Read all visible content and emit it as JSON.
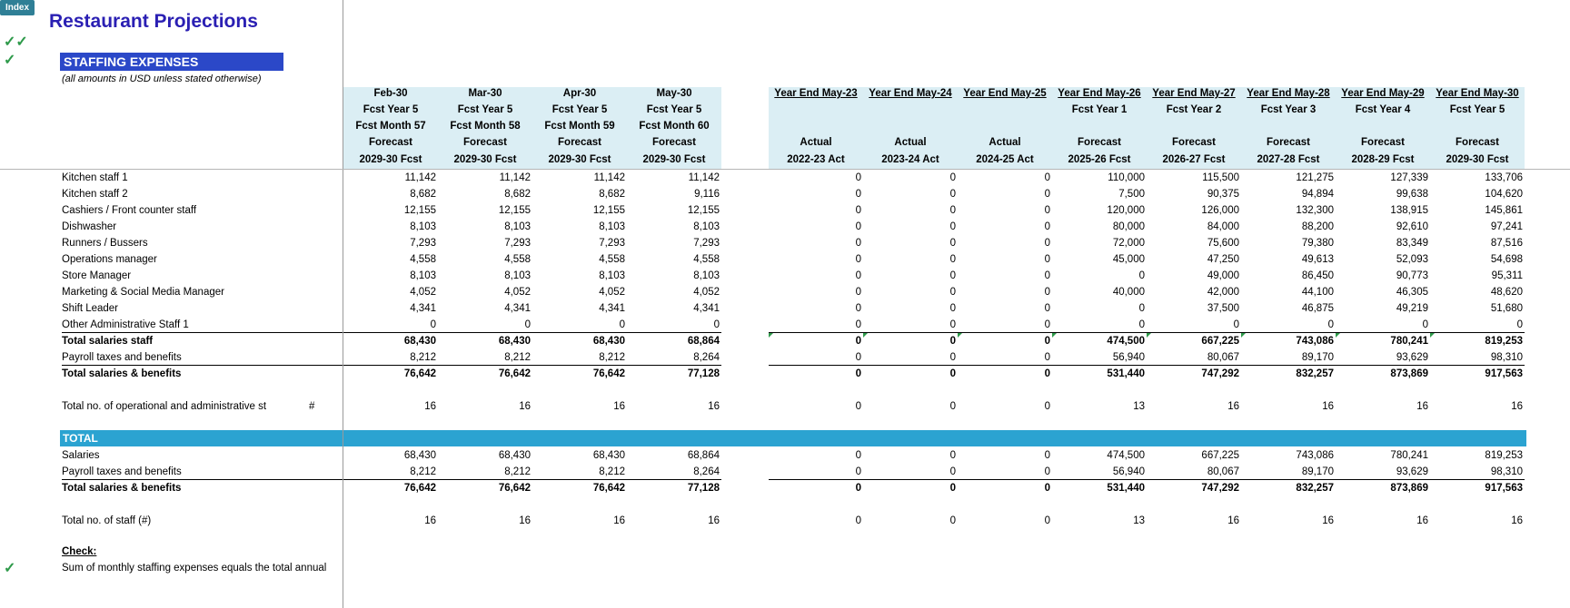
{
  "app": {
    "index_button": "Index",
    "title": "Restaurant Projections",
    "section": "STAFFING EXPENSES",
    "subtitle": "(all amounts in USD unless stated otherwise)",
    "check_mark": "✓",
    "double_check": "✓✓"
  },
  "colors": {
    "title": "#2a1fb3",
    "banner": "#2b48c8",
    "total_banner": "#2ba3d1",
    "header_bg": "#dbeef4",
    "check": "#2e9a4a"
  },
  "monthly_columns": [
    {
      "h1": "Feb-30",
      "h2": "Fcst Year 5",
      "h3": "Fcst Month 57",
      "h4": "Forecast",
      "h5": "2029-30 Fcst"
    },
    {
      "h1": "Mar-30",
      "h2": "Fcst Year 5",
      "h3": "Fcst Month 58",
      "h4": "Forecast",
      "h5": "2029-30 Fcst"
    },
    {
      "h1": "Apr-30",
      "h2": "Fcst Year 5",
      "h3": "Fcst Month 59",
      "h4": "Forecast",
      "h5": "2029-30 Fcst"
    },
    {
      "h1": "May-30",
      "h2": "Fcst Year 5",
      "h3": "Fcst Month 60",
      "h4": "Forecast",
      "h5": "2029-30 Fcst"
    }
  ],
  "annual_columns": [
    {
      "h1": "Year End  May-23",
      "h2": "",
      "h4": "Actual",
      "h5": "2022-23 Act"
    },
    {
      "h1": "Year End  May-24",
      "h2": "",
      "h4": "Actual",
      "h5": "2023-24 Act"
    },
    {
      "h1": "Year End  May-25",
      "h2": "",
      "h4": "Actual",
      "h5": "2024-25 Act"
    },
    {
      "h1": "Year End  May-26",
      "h2": "Fcst Year 1",
      "h4": "Forecast",
      "h5": "2025-26 Fcst"
    },
    {
      "h1": "Year End  May-27",
      "h2": "Fcst Year 2",
      "h4": "Forecast",
      "h5": "2026-27 Fcst"
    },
    {
      "h1": "Year End  May-28",
      "h2": "Fcst Year 3",
      "h4": "Forecast",
      "h5": "2027-28 Fcst"
    },
    {
      "h1": "Year End  May-29",
      "h2": "Fcst Year 4",
      "h4": "Forecast",
      "h5": "2028-29 Fcst"
    },
    {
      "h1": "Year End  May-30",
      "h2": "Fcst Year 5",
      "h4": "Forecast",
      "h5": "2029-30 Fcst"
    }
  ],
  "rows": [
    {
      "label": "Kitchen staff 1",
      "m": [
        "11,142",
        "11,142",
        "11,142",
        "11,142"
      ],
      "a": [
        "0",
        "0",
        "0",
        "110,000",
        "115,500",
        "121,275",
        "127,339",
        "133,706"
      ]
    },
    {
      "label": "Kitchen staff 2",
      "m": [
        "8,682",
        "8,682",
        "8,682",
        "9,116"
      ],
      "a": [
        "0",
        "0",
        "0",
        "7,500",
        "90,375",
        "94,894",
        "99,638",
        "104,620"
      ]
    },
    {
      "label": "Cashiers / Front counter staff",
      "m": [
        "12,155",
        "12,155",
        "12,155",
        "12,155"
      ],
      "a": [
        "0",
        "0",
        "0",
        "120,000",
        "126,000",
        "132,300",
        "138,915",
        "145,861"
      ]
    },
    {
      "label": "Dishwasher",
      "m": [
        "8,103",
        "8,103",
        "8,103",
        "8,103"
      ],
      "a": [
        "0",
        "0",
        "0",
        "80,000",
        "84,000",
        "88,200",
        "92,610",
        "97,241"
      ]
    },
    {
      "label": "Runners / Bussers",
      "m": [
        "7,293",
        "7,293",
        "7,293",
        "7,293"
      ],
      "a": [
        "0",
        "0",
        "0",
        "72,000",
        "75,600",
        "79,380",
        "83,349",
        "87,516"
      ]
    },
    {
      "label": "Operations manager",
      "m": [
        "4,558",
        "4,558",
        "4,558",
        "4,558"
      ],
      "a": [
        "0",
        "0",
        "0",
        "45,000",
        "47,250",
        "49,613",
        "52,093",
        "54,698"
      ]
    },
    {
      "label": "Store Manager",
      "m": [
        "8,103",
        "8,103",
        "8,103",
        "8,103"
      ],
      "a": [
        "0",
        "0",
        "0",
        "0",
        "49,000",
        "86,450",
        "90,773",
        "95,311"
      ]
    },
    {
      "label": "Marketing & Social Media Manager",
      "m": [
        "4,052",
        "4,052",
        "4,052",
        "4,052"
      ],
      "a": [
        "0",
        "0",
        "0",
        "40,000",
        "42,000",
        "44,100",
        "46,305",
        "48,620"
      ]
    },
    {
      "label": "Shift Leader",
      "m": [
        "4,341",
        "4,341",
        "4,341",
        "4,341"
      ],
      "a": [
        "0",
        "0",
        "0",
        "0",
        "37,500",
        "46,875",
        "49,219",
        "51,680"
      ]
    },
    {
      "label": "Other Administrative Staff 1",
      "m": [
        "0",
        "0",
        "0",
        "0"
      ],
      "a": [
        "0",
        "0",
        "0",
        "0",
        "0",
        "0",
        "0",
        "0"
      ]
    },
    {
      "label": "Total salaries staff",
      "bold": true,
      "m": [
        "68,430",
        "68,430",
        "68,430",
        "68,864"
      ],
      "a": [
        "0",
        "0",
        "0",
        "474,500",
        "667,225",
        "743,086",
        "780,241",
        "819,253"
      ]
    },
    {
      "label": "Payroll taxes and benefits",
      "m": [
        "8,212",
        "8,212",
        "8,212",
        "8,264"
      ],
      "a": [
        "0",
        "0",
        "0",
        "56,940",
        "80,067",
        "89,170",
        "93,629",
        "98,310"
      ]
    },
    {
      "label": "Total salaries & benefits",
      "bold": true,
      "m": [
        "76,642",
        "76,642",
        "76,642",
        "77,128"
      ],
      "a": [
        "0",
        "0",
        "0",
        "531,440",
        "747,292",
        "832,257",
        "873,869",
        "917,563"
      ]
    }
  ],
  "headcount": {
    "label": "Total no. of operational and administrative st",
    "unit": "#",
    "m": [
      "16",
      "16",
      "16",
      "16"
    ],
    "a": [
      "0",
      "0",
      "0",
      "13",
      "16",
      "16",
      "16",
      "16"
    ]
  },
  "total_section": {
    "banner": "TOTAL",
    "rows": [
      {
        "label": "Salaries",
        "m": [
          "68,430",
          "68,430",
          "68,430",
          "68,864"
        ],
        "a": [
          "0",
          "0",
          "0",
          "474,500",
          "667,225",
          "743,086",
          "780,241",
          "819,253"
        ]
      },
      {
        "label": "Payroll taxes and benefits",
        "m": [
          "8,212",
          "8,212",
          "8,212",
          "8,264"
        ],
        "a": [
          "0",
          "0",
          "0",
          "56,940",
          "80,067",
          "89,170",
          "93,629",
          "98,310"
        ]
      },
      {
        "label": "Total salaries & benefits",
        "bold": true,
        "m": [
          "76,642",
          "76,642",
          "76,642",
          "77,128"
        ],
        "a": [
          "0",
          "0",
          "0",
          "531,440",
          "747,292",
          "832,257",
          "873,869",
          "917,563"
        ]
      }
    ],
    "staff": {
      "label": "Total no. of staff (#)",
      "m": [
        "16",
        "16",
        "16",
        "16"
      ],
      "a": [
        "0",
        "0",
        "0",
        "13",
        "16",
        "16",
        "16",
        "16"
      ]
    }
  },
  "check": {
    "title": "Check:",
    "text": "Sum of monthly staffing expenses equals the total annual"
  }
}
